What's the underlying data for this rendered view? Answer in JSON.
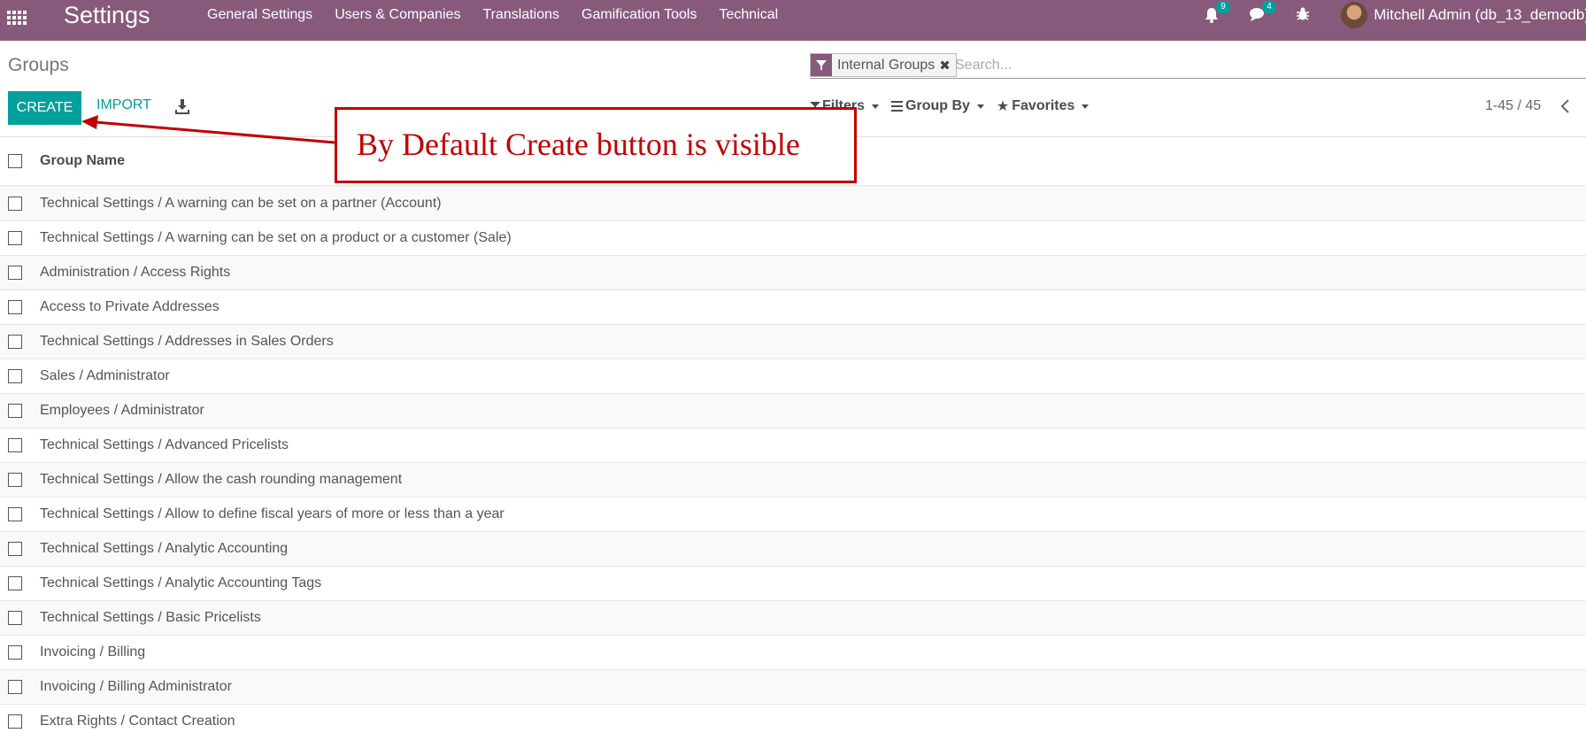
{
  "navbar": {
    "brand": "Settings",
    "menu": [
      "General Settings",
      "Users & Companies",
      "Translations",
      "Gamification Tools",
      "Technical"
    ],
    "activity_count": "9",
    "messages_count": "4",
    "user_name": "Mitchell Admin (db_13_demodb)",
    "color": "#875a7b"
  },
  "control_panel": {
    "breadcrumb": "Groups",
    "create_label": "CREATE",
    "import_label": "IMPORT",
    "search": {
      "facet": "Internal Groups",
      "placeholder": "Search..."
    },
    "filters_label": "Filters",
    "group_by_label": "Group By",
    "favorites_label": "Favorites",
    "pager": "1-45 / 45",
    "accent": "#00a09d"
  },
  "table": {
    "header": "Group Name",
    "rows": [
      "Technical Settings / A warning can be set on a partner (Account)",
      "Technical Settings / A warning can be set on a product or a customer (Sale)",
      "Administration / Access Rights",
      "Access to Private Addresses",
      "Technical Settings / Addresses in Sales Orders",
      "Sales / Administrator",
      "Employees / Administrator",
      "Technical Settings / Advanced Pricelists",
      "Technical Settings / Allow the cash rounding management",
      "Technical Settings / Allow to define fiscal years of more or less than a year",
      "Technical Settings / Analytic Accounting",
      "Technical Settings / Analytic Accounting Tags",
      "Technical Settings / Basic Pricelists",
      "Invoicing / Billing",
      "Invoicing / Billing Administrator",
      "Extra Rights / Contact Creation"
    ]
  },
  "annotation": {
    "text": "By Default Create button is visible",
    "color": "#c00000"
  }
}
